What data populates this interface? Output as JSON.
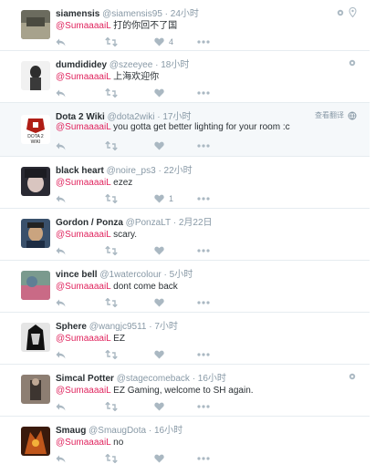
{
  "tweets": [
    {
      "fullname": "siamensis",
      "username": "@siamensis95",
      "time": "· 24小时",
      "mention": "@SumaaaaiL",
      "text": "打的你回不了国",
      "likes": "4",
      "avatar_colors": [
        "#6b6b5e",
        "#a7a28c"
      ]
    },
    {
      "fullname": "dumdididey",
      "username": "@szeeyee",
      "time": "· 18小时",
      "mention": "@SumaaaaiL",
      "text": "上海欢迎你",
      "likes": "",
      "avatar_colors": [
        "#f1f1f1",
        "#2d2d2d"
      ]
    },
    {
      "fullname": "Dota 2 Wiki",
      "username": "@dota2wiki",
      "time": "· 17小时",
      "mention": "@SumaaaaiL",
      "text": "you gotta get better lighting for your room :c",
      "likes": "",
      "translate": "查看翻译",
      "avatar_colors": [
        "#ffffff",
        "#b01e16"
      ],
      "avatar_text": "DOTA 2 WIKI"
    },
    {
      "fullname": "black heart",
      "username": "@noire_ps3",
      "time": "· 22小时",
      "mention": "@SumaaaaiL",
      "text": "ezez",
      "likes": "1",
      "avatar_colors": [
        "#2a2a33",
        "#d9c5c0"
      ]
    },
    {
      "fullname": "Gordon / Ponza",
      "username": "@PonzaLT",
      "time": "· 2月22日",
      "mention": "@SumaaaaiL",
      "text": "scary.",
      "likes": "",
      "avatar_colors": [
        "#39506b",
        "#caa47f"
      ]
    },
    {
      "fullname": "vince bell",
      "username": "@1watercolour",
      "time": "· 5小时",
      "mention": "@SumaaaaiL",
      "text": "dont come back",
      "likes": "",
      "avatar_colors": [
        "#7a9a8e",
        "#c96a86"
      ]
    },
    {
      "fullname": "Sphere",
      "username": "@wangjc9511",
      "time": "· 7小时",
      "mention": "@SumaaaaiL",
      "text": "EZ",
      "likes": "",
      "avatar_colors": [
        "#e5e5e5",
        "#111111"
      ]
    },
    {
      "fullname": "Simcal Potter",
      "username": "@stagecomeback",
      "time": "· 16小时",
      "mention": "@SumaaaaiL",
      "text": "EZ Gaming, welcome to SH again.",
      "likes": "",
      "avatar_colors": [
        "#8d7e72",
        "#3d3530"
      ]
    },
    {
      "fullname": "Smaug",
      "username": "@SmaugDota",
      "time": "· 16小时",
      "mention": "@SumaaaaiL",
      "text": "no",
      "likes": "",
      "avatar_colors": [
        "#c0561b",
        "#3a1a0c"
      ]
    }
  ]
}
